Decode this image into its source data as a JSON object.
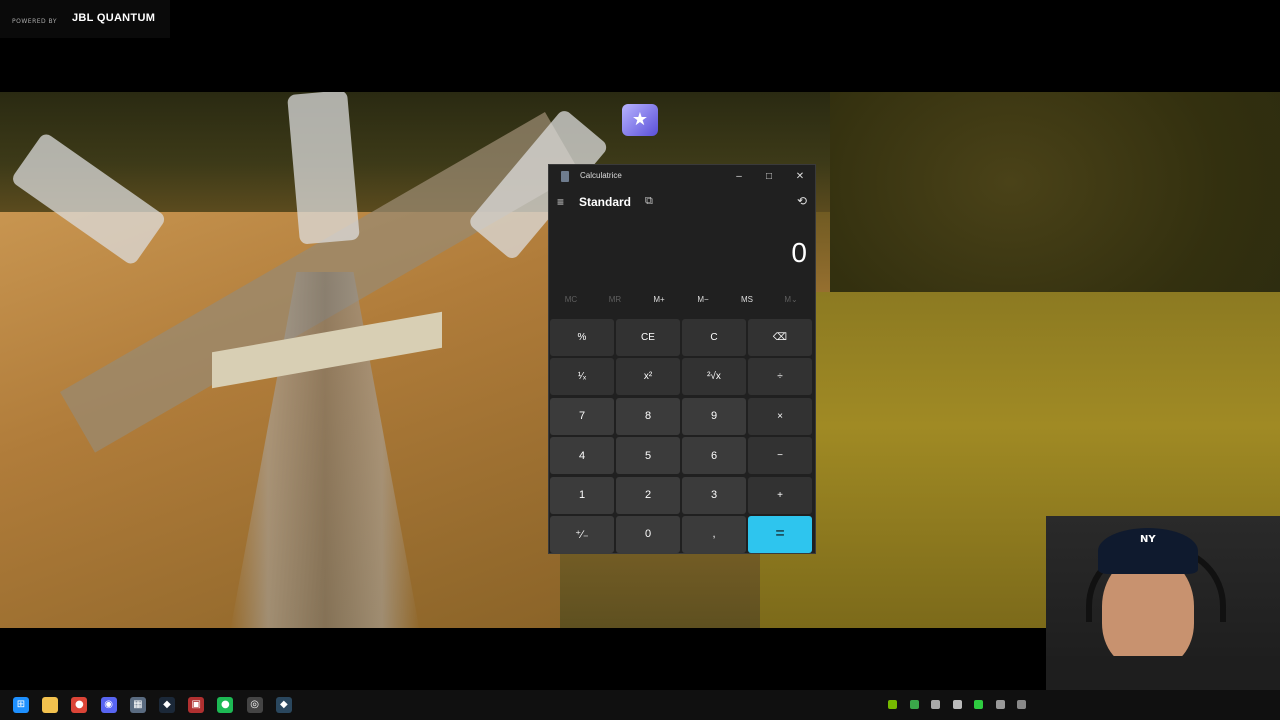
{
  "overlay": {
    "powered_by": "POWERED BY",
    "brand": "JBL QUANTUM"
  },
  "calculator": {
    "title": "Calculatrice",
    "window_buttons": {
      "minimize": "–",
      "maximize": "□",
      "close": "✕"
    },
    "menu_icon": "≡",
    "mode": "Standard",
    "keep_on_top_icon": "⧉",
    "history_icon": "⟲",
    "display_value": "0",
    "memory": [
      {
        "label": "MC",
        "enabled": false
      },
      {
        "label": "MR",
        "enabled": false
      },
      {
        "label": "M+",
        "enabled": true
      },
      {
        "label": "M−",
        "enabled": true
      },
      {
        "label": "MS",
        "enabled": true
      },
      {
        "label": "M⌄",
        "enabled": false
      }
    ],
    "keys": [
      {
        "label": "%",
        "name": "percent-button",
        "type": "op"
      },
      {
        "label": "CE",
        "name": "clear-entry-button",
        "type": "op"
      },
      {
        "label": "C",
        "name": "clear-button",
        "type": "op"
      },
      {
        "label": "⌫",
        "name": "backspace-button",
        "type": "op"
      },
      {
        "label": "¹⁄ₓ",
        "name": "reciprocal-button",
        "type": "op"
      },
      {
        "label": "x²",
        "name": "square-button",
        "type": "op"
      },
      {
        "label": "²√x",
        "name": "square-root-button",
        "type": "op"
      },
      {
        "label": "÷",
        "name": "divide-button",
        "type": "op"
      },
      {
        "label": "7",
        "name": "digit-7-button",
        "type": "num"
      },
      {
        "label": "8",
        "name": "digit-8-button",
        "type": "num"
      },
      {
        "label": "9",
        "name": "digit-9-button",
        "type": "num"
      },
      {
        "label": "×",
        "name": "multiply-button",
        "type": "op"
      },
      {
        "label": "4",
        "name": "digit-4-button",
        "type": "num"
      },
      {
        "label": "5",
        "name": "digit-5-button",
        "type": "num"
      },
      {
        "label": "6",
        "name": "digit-6-button",
        "type": "num"
      },
      {
        "label": "−",
        "name": "subtract-button",
        "type": "op"
      },
      {
        "label": "1",
        "name": "digit-1-button",
        "type": "num"
      },
      {
        "label": "2",
        "name": "digit-2-button",
        "type": "num"
      },
      {
        "label": "3",
        "name": "digit-3-button",
        "type": "num"
      },
      {
        "label": "+",
        "name": "add-button",
        "type": "op"
      },
      {
        "label": "⁺∕₋",
        "name": "negate-button",
        "type": "num"
      },
      {
        "label": "0",
        "name": "digit-0-button",
        "type": "num"
      },
      {
        "label": ",",
        "name": "decimal-button",
        "type": "num"
      },
      {
        "label": "=",
        "name": "equals-button",
        "type": "equals"
      }
    ],
    "accent_color": "#2ec5ee"
  },
  "webcam": {
    "cap_logo": "NY"
  },
  "taskbar": {
    "apps": [
      {
        "name": "windows-start-icon",
        "color": "#1e90ff",
        "glyph": "⊞"
      },
      {
        "name": "file-explorer-icon",
        "color": "#f2c14e",
        "glyph": ""
      },
      {
        "name": "chrome-icon",
        "color": "#db4437",
        "glyph": "●"
      },
      {
        "name": "discord-icon",
        "color": "#5865f2",
        "glyph": "◉"
      },
      {
        "name": "calculator-icon",
        "color": "#5a6b80",
        "glyph": "▦"
      },
      {
        "name": "steam-icon",
        "color": "#1b2838",
        "glyph": "◆"
      },
      {
        "name": "media-app-icon",
        "color": "#b03030",
        "glyph": "▣"
      },
      {
        "name": "spotify-icon",
        "color": "#1db954",
        "glyph": "●"
      },
      {
        "name": "obs-icon",
        "color": "#444",
        "glyph": "◎"
      },
      {
        "name": "steam-alt-icon",
        "color": "#2a475e",
        "glyph": "◆"
      }
    ],
    "tray": [
      {
        "name": "nvidia-tray-icon",
        "color": "#76b900"
      },
      {
        "name": "gpu-tray-icon",
        "color": "#3aa84a"
      },
      {
        "name": "discord-tray-icon",
        "color": "#aaaaaa"
      },
      {
        "name": "network-tray-icon",
        "color": "#bbbbbb"
      },
      {
        "name": "green-tray-icon",
        "color": "#2ecc40"
      },
      {
        "name": "steam-tray-icon",
        "color": "#999999"
      },
      {
        "name": "settings-tray-icon",
        "color": "#888888"
      }
    ]
  }
}
